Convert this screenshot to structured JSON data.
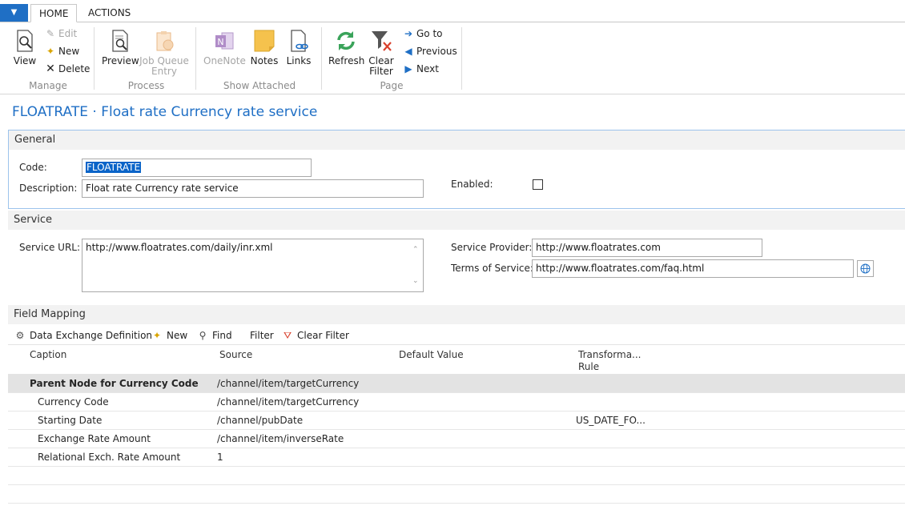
{
  "ribbon": {
    "tabs": [
      {
        "label": "HOME",
        "active": true
      },
      {
        "label": "ACTIONS",
        "active": false
      }
    ],
    "app_button_icon": "chevron-down-icon",
    "manage": {
      "group_label": "Manage",
      "view": "View",
      "edit": "Edit",
      "new": "New",
      "delete": "Delete"
    },
    "process": {
      "group_label": "Process",
      "preview": "Preview",
      "job_queue_line1": "Job Queue",
      "job_queue_line2": "Entry"
    },
    "show_attached": {
      "group_label": "Show Attached",
      "onenote": "OneNote",
      "notes": "Notes",
      "links": "Links"
    },
    "page": {
      "group_label": "Page",
      "refresh": "Refresh",
      "clear_filter_line1": "Clear",
      "clear_filter_line2": "Filter",
      "go_to": "Go to",
      "previous": "Previous",
      "next": "Next"
    }
  },
  "page_title": "FLOATRATE · Float rate Currency rate service",
  "general": {
    "header": "General",
    "code_label": "Code:",
    "code_value": "FLOATRATE",
    "description_label": "Description:",
    "description_value": "Float rate Currency rate service",
    "enabled_label": "Enabled:",
    "enabled": false
  },
  "service": {
    "header": "Service",
    "url_label": "Service URL:",
    "url_value": "http://www.floatrates.com/daily/inr.xml",
    "provider_label": "Service Provider:",
    "provider_value": "http://www.floatrates.com",
    "terms_label": "Terms of Service:",
    "terms_value": "http://www.floatrates.com/faq.html"
  },
  "field_mapping": {
    "header": "Field Mapping",
    "toolbar": {
      "data_exchange": "Data Exchange Definition",
      "new": "New",
      "find": "Find",
      "filter": "Filter",
      "clear_filter": "Clear Filter"
    },
    "columns": {
      "caption": "Caption",
      "source": "Source",
      "default_value": "Default Value",
      "transform_line1": "Transforma...",
      "transform_line2": "Rule"
    },
    "rows": [
      {
        "caption": "Parent Node for Currency Code",
        "source": "/channel/item/targetCurrency",
        "default": "",
        "transform": ""
      },
      {
        "caption": "Currency Code",
        "source": "/channel/item/targetCurrency",
        "default": "",
        "transform": ""
      },
      {
        "caption": "Starting Date",
        "source": "/channel/pubDate",
        "default": "",
        "transform": "US_DATE_FO..."
      },
      {
        "caption": "Exchange Rate Amount",
        "source": "/channel/item/inverseRate",
        "default": "",
        "transform": ""
      },
      {
        "caption": "Relational Exch. Rate Amount",
        "source": "1",
        "default": "",
        "transform": ""
      }
    ]
  },
  "colors": {
    "accent": "#1f6fc5",
    "selection": "#0a64c8",
    "section_bg": "#f2f2f2"
  }
}
